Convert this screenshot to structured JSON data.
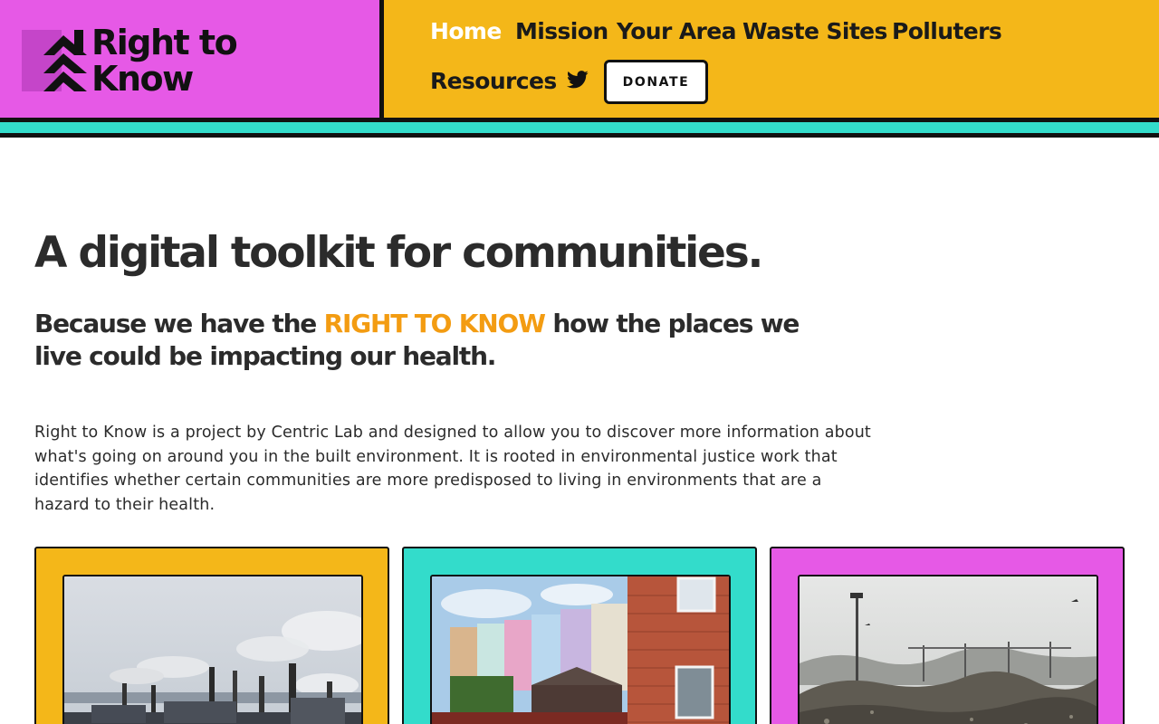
{
  "colors": {
    "pink": "#e659e6",
    "yellow": "#f4b719",
    "teal": "#33dccb",
    "orange_highlight": "#f39c12",
    "dark": "#111111",
    "text": "#2b2b2b"
  },
  "logo": {
    "line1": "Right to",
    "line2": "Know",
    "icon": "chevron-up-logo-icon"
  },
  "nav": {
    "items": [
      {
        "label": "Home",
        "active": true
      },
      {
        "label": "Mission",
        "active": false
      },
      {
        "label": "Your Area",
        "active": false
      },
      {
        "label": "Waste Sites",
        "active": false
      },
      {
        "label": "Polluters",
        "active": false
      },
      {
        "label": "Resources",
        "active": false
      }
    ],
    "twitter_icon": "twitter-icon",
    "donate_label": "DONATE"
  },
  "hero": {
    "title": "A digital toolkit for communities.",
    "tagline_before": "Because we have the ",
    "tagline_highlight": "RIGHT TO KNOW",
    "tagline_after": " how the places we live could be impacting our health.",
    "intro": "Right to Know is a project by Centric Lab and designed to allow you to discover more information about what's going on around you in the built environment. It is rooted in environmental justice work that identifies whether certain communities are more predisposed to living in environments that are a hazard to their health."
  },
  "cards": [
    {
      "image": "industrial-smokestacks-photo"
    },
    {
      "image": "colorful-terraced-houses-photo"
    },
    {
      "image": "landfill-waste-site-photo"
    }
  ]
}
